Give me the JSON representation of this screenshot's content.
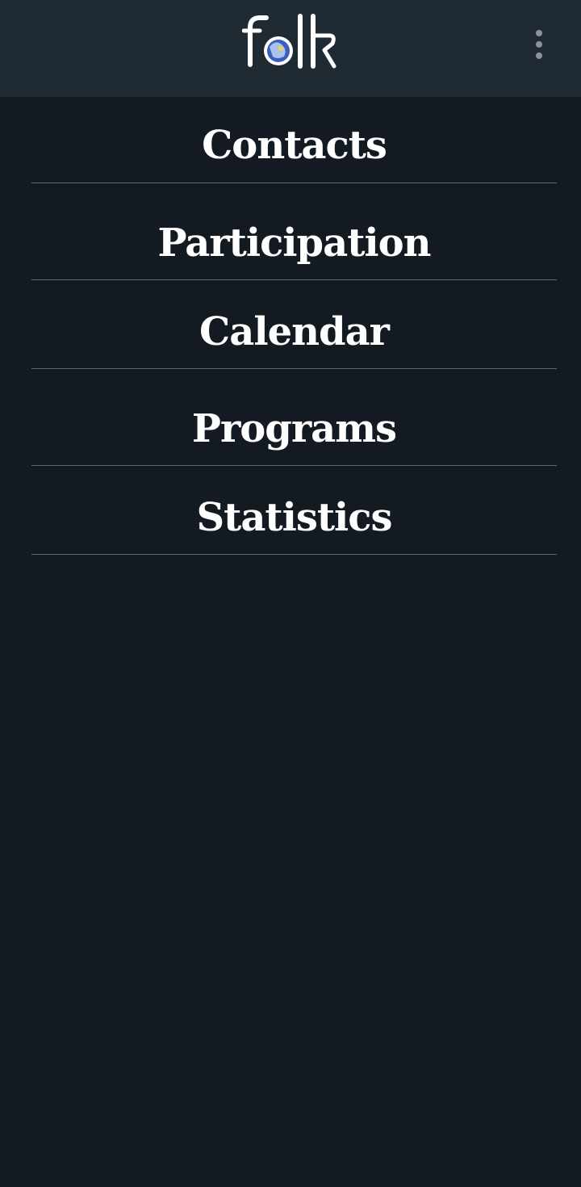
{
  "header": {
    "logo_text": "folk",
    "menu_icon": "more-vert-icon"
  },
  "menu": {
    "items": [
      {
        "label": "Contacts"
      },
      {
        "label": "Participation"
      },
      {
        "label": "Calendar"
      },
      {
        "label": "Programs"
      },
      {
        "label": "Statistics"
      }
    ]
  },
  "colors": {
    "background": "#141a21",
    "header_background": "#1f2a33",
    "divider": "#5d666e",
    "text": "#ffffff",
    "logo_globe": "#3b5fbf"
  }
}
